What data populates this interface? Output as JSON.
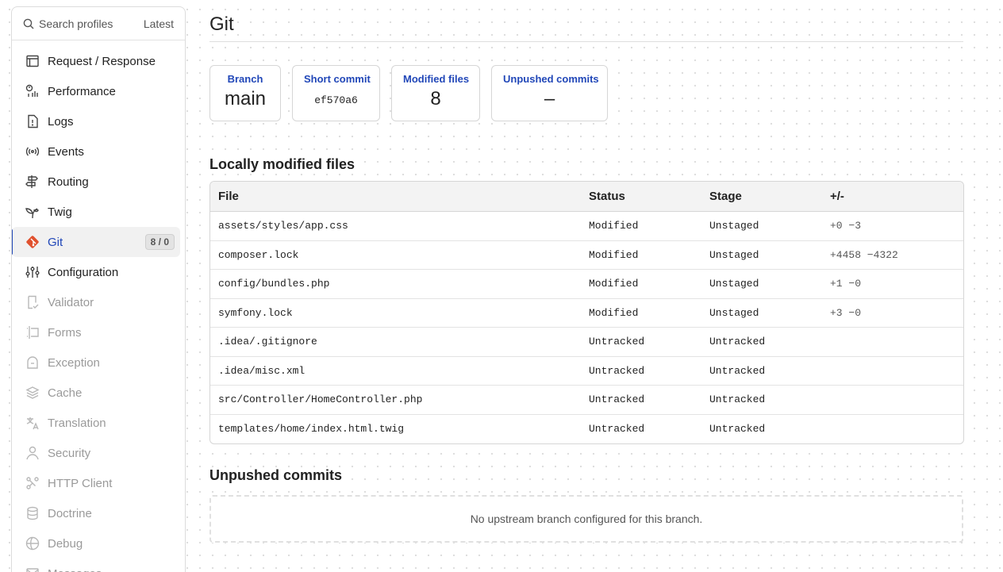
{
  "sidebar": {
    "search_label": "Search profiles",
    "latest_label": "Latest",
    "items": [
      {
        "label": "Request / Response",
        "icon": "request-response-icon",
        "state": "normal"
      },
      {
        "label": "Performance",
        "icon": "performance-icon",
        "state": "normal"
      },
      {
        "label": "Logs",
        "icon": "logs-icon",
        "state": "normal"
      },
      {
        "label": "Events",
        "icon": "events-icon",
        "state": "normal"
      },
      {
        "label": "Routing",
        "icon": "routing-icon",
        "state": "normal"
      },
      {
        "label": "Twig",
        "icon": "twig-icon",
        "state": "normal"
      },
      {
        "label": "Git",
        "icon": "git-icon",
        "state": "active",
        "badge": "8 / 0"
      },
      {
        "label": "Configuration",
        "icon": "configuration-icon",
        "state": "normal"
      },
      {
        "label": "Validator",
        "icon": "validator-icon",
        "state": "disabled"
      },
      {
        "label": "Forms",
        "icon": "forms-icon",
        "state": "disabled"
      },
      {
        "label": "Exception",
        "icon": "exception-icon",
        "state": "disabled"
      },
      {
        "label": "Cache",
        "icon": "cache-icon",
        "state": "disabled"
      },
      {
        "label": "Translation",
        "icon": "translation-icon",
        "state": "disabled"
      },
      {
        "label": "Security",
        "icon": "security-icon",
        "state": "disabled"
      },
      {
        "label": "HTTP Client",
        "icon": "http-client-icon",
        "state": "disabled"
      },
      {
        "label": "Doctrine",
        "icon": "doctrine-icon",
        "state": "disabled"
      },
      {
        "label": "Debug",
        "icon": "debug-icon",
        "state": "disabled"
      },
      {
        "label": "Messages",
        "icon": "messages-icon",
        "state": "disabled"
      }
    ]
  },
  "main": {
    "title": "Git",
    "metrics": [
      {
        "label": "Branch",
        "value": "main"
      },
      {
        "label": "Short commit",
        "value": "ef570a6"
      },
      {
        "label": "Modified files",
        "value": "8"
      },
      {
        "label": "Unpushed commits",
        "value": "–"
      }
    ],
    "files_section_title": "Locally modified files",
    "files_table": {
      "headers": [
        "File",
        "Status",
        "Stage",
        "+/-"
      ],
      "rows": [
        [
          "assets/styles/app.css",
          "Modified",
          "Unstaged",
          "+0 −3"
        ],
        [
          "composer.lock",
          "Modified",
          "Unstaged",
          "+4458 −4322"
        ],
        [
          "config/bundles.php",
          "Modified",
          "Unstaged",
          "+1 −0"
        ],
        [
          "symfony.lock",
          "Modified",
          "Unstaged",
          "+3 −0"
        ],
        [
          ".idea/.gitignore",
          "Untracked",
          "Untracked",
          ""
        ],
        [
          ".idea/misc.xml",
          "Untracked",
          "Untracked",
          ""
        ],
        [
          "src/Controller/HomeController.php",
          "Untracked",
          "Untracked",
          ""
        ],
        [
          "templates/home/index.html.twig",
          "Untracked",
          "Untracked",
          ""
        ]
      ]
    },
    "unpushed_section_title": "Unpushed commits",
    "unpushed_empty_message": "No upstream branch configured for this branch."
  },
  "colors": {
    "accent": "#2147b8",
    "git_logo": "#e0512e",
    "disabled_text": "#9a9a9a"
  }
}
